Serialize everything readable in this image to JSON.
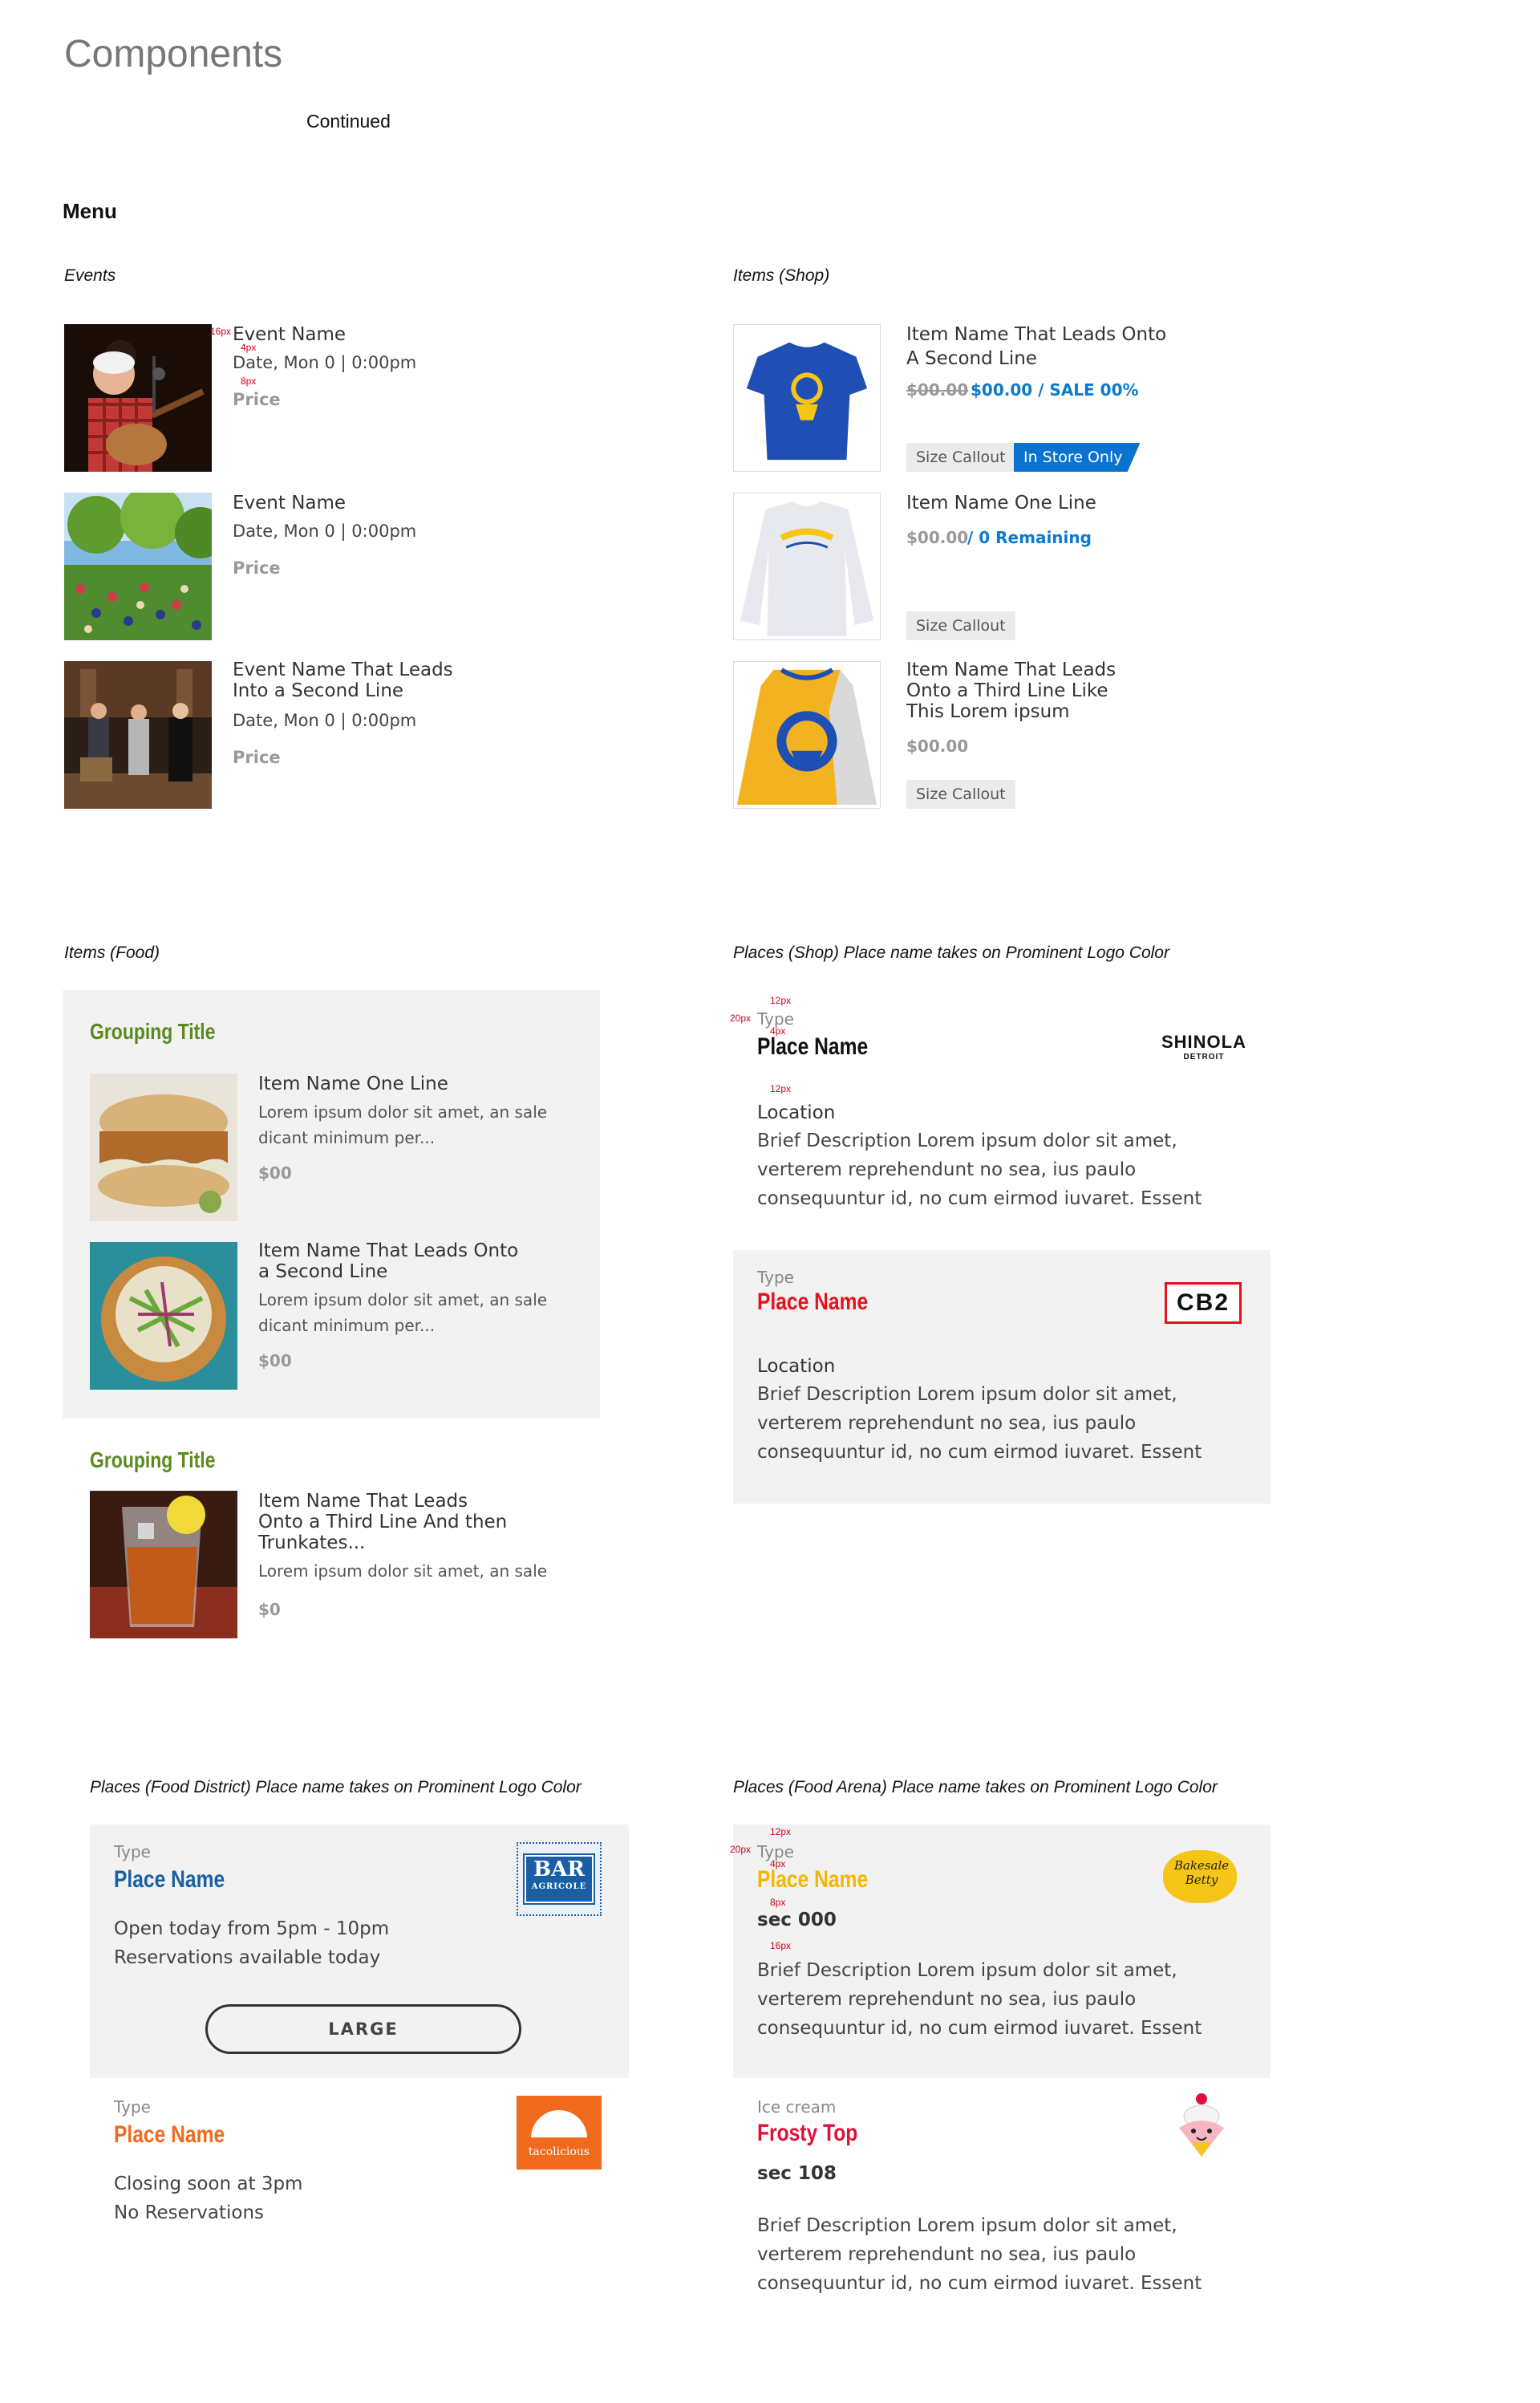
{
  "header": {
    "title": "Components",
    "continued": "Continued",
    "menu": "Menu"
  },
  "events": {
    "label": "Events",
    "items": [
      {
        "title": "Event Name",
        "date": "Date, Mon 0 | 0:00pm",
        "price": "Price"
      },
      {
        "title": "Event Name",
        "date": "Date, Mon 0 | 0:00pm",
        "price": "Price"
      },
      {
        "title_line1": "Event Name That Leads",
        "title_line2": "Into a Second Line",
        "date": "Date, Mon 0 | 0:00pm",
        "price": "Price"
      }
    ],
    "spec": {
      "a": "16px",
      "b": "4px",
      "c": "8px"
    }
  },
  "shop": {
    "label": "Items (Shop)",
    "items": [
      {
        "title_line1": "Item Name That Leads Onto",
        "title_line2": "A Second Line",
        "old_price": "$00.00",
        "sale_price": "$00.00 / SALE 00%",
        "callout": "Size Callout",
        "badge": "In Store Only"
      },
      {
        "title": "Item Name One Line",
        "price": "$00.00",
        "remaining": "/ 0 Remaining",
        "callout": "Size Callout"
      },
      {
        "title_line1": "Item Name That Leads",
        "title_line2": "Onto a Third Line Like",
        "title_line3": "This Lorem ipsum",
        "price": "$00.00",
        "callout": "Size Callout"
      }
    ]
  },
  "food": {
    "label": "Items (Food)",
    "groups": [
      {
        "title": "Grouping Title",
        "items": [
          {
            "title": "Item Name One Line",
            "desc1": "Lorem ipsum dolor sit amet, an sale",
            "desc2": "dicant minimum per...",
            "price": "$00"
          },
          {
            "title_line1": "Item Name That Leads Onto",
            "title_line2": "a Second Line",
            "desc1": "Lorem ipsum dolor sit amet, an sale",
            "desc2": "dicant minimum per...",
            "price": "$00"
          }
        ]
      },
      {
        "title": "Grouping Title",
        "items": [
          {
            "title_line1": "Item Name That Leads",
            "title_line2": "Onto a Third Line And then",
            "title_line3": "Trunkates...",
            "desc1": "Lorem ipsum dolor sit amet, an sale",
            "price": "$0"
          }
        ]
      }
    ]
  },
  "places_shop": {
    "label": "Places (Shop) Place name takes on Prominent Logo Color",
    "spec": {
      "a": "12px",
      "b": "20px",
      "c": "4px",
      "d": "12px"
    },
    "items": [
      {
        "type": "Type",
        "name": "Place Name",
        "location": "Location",
        "desc1": "Brief Description Lorem ipsum dolor sit amet,",
        "desc2": "verterem reprehendunt no sea, ius paulo",
        "desc3": "consequuntur id, no cum eirmod iuvaret. Essent",
        "logo1": "SHINOLA",
        "logo2": "DETROIT"
      },
      {
        "type": "Type",
        "name": "Place Name",
        "location": "Location",
        "desc1": "Brief Description Lorem ipsum dolor sit amet,",
        "desc2": "verterem reprehendunt no sea, ius paulo",
        "desc3": "consequuntur id, no cum eirmod iuvaret. Essent",
        "logo": "CB2"
      }
    ]
  },
  "places_district": {
    "label": "Places (Food District) Place name takes on Prominent Logo Color",
    "items": [
      {
        "type": "Type",
        "name": "Place Name",
        "line1": "Open today from 5pm - 10pm",
        "line2": "Reservations available today",
        "button": "LARGE",
        "logo1": "BAR",
        "logo2": "AGRICOLE"
      },
      {
        "type": "Type",
        "name": "Place Name",
        "line1": "Closing soon at 3pm",
        "line2": "No Reservations",
        "logo": "tacolicious"
      }
    ]
  },
  "places_arena": {
    "label": "Places (Food Arena) Place name takes on Prominent Logo Color",
    "spec": {
      "a": "12px",
      "b": "20px",
      "c": "4px",
      "d": "8px",
      "e": "16px"
    },
    "items": [
      {
        "type": "Type",
        "name": "Place Name",
        "section": "sec 000",
        "desc1": "Brief Description Lorem ipsum dolor sit amet,",
        "desc2": "verterem reprehendunt no sea, ius paulo",
        "desc3": "consequuntur id, no cum eirmod iuvaret. Essent",
        "logo1": "Bakesale",
        "logo2": "Betty"
      },
      {
        "type": "Ice cream",
        "name": "Frosty Top",
        "section": "sec 108",
        "desc1": "Brief Description Lorem ipsum dolor sit amet,",
        "desc2": "verterem reprehendunt no sea, ius paulo",
        "desc3": "consequuntur id, no cum eirmod iuvaret. Essent"
      }
    ]
  },
  "colors": {
    "sale_blue": "#0a73d2",
    "group_green": "#5b8a1f",
    "place_blue": "#1a5fa3",
    "place_red": "#e8101a",
    "place_orange": "#f06a1d",
    "place_yellow": "#f2b705",
    "frosty_red": "#e0103a"
  }
}
